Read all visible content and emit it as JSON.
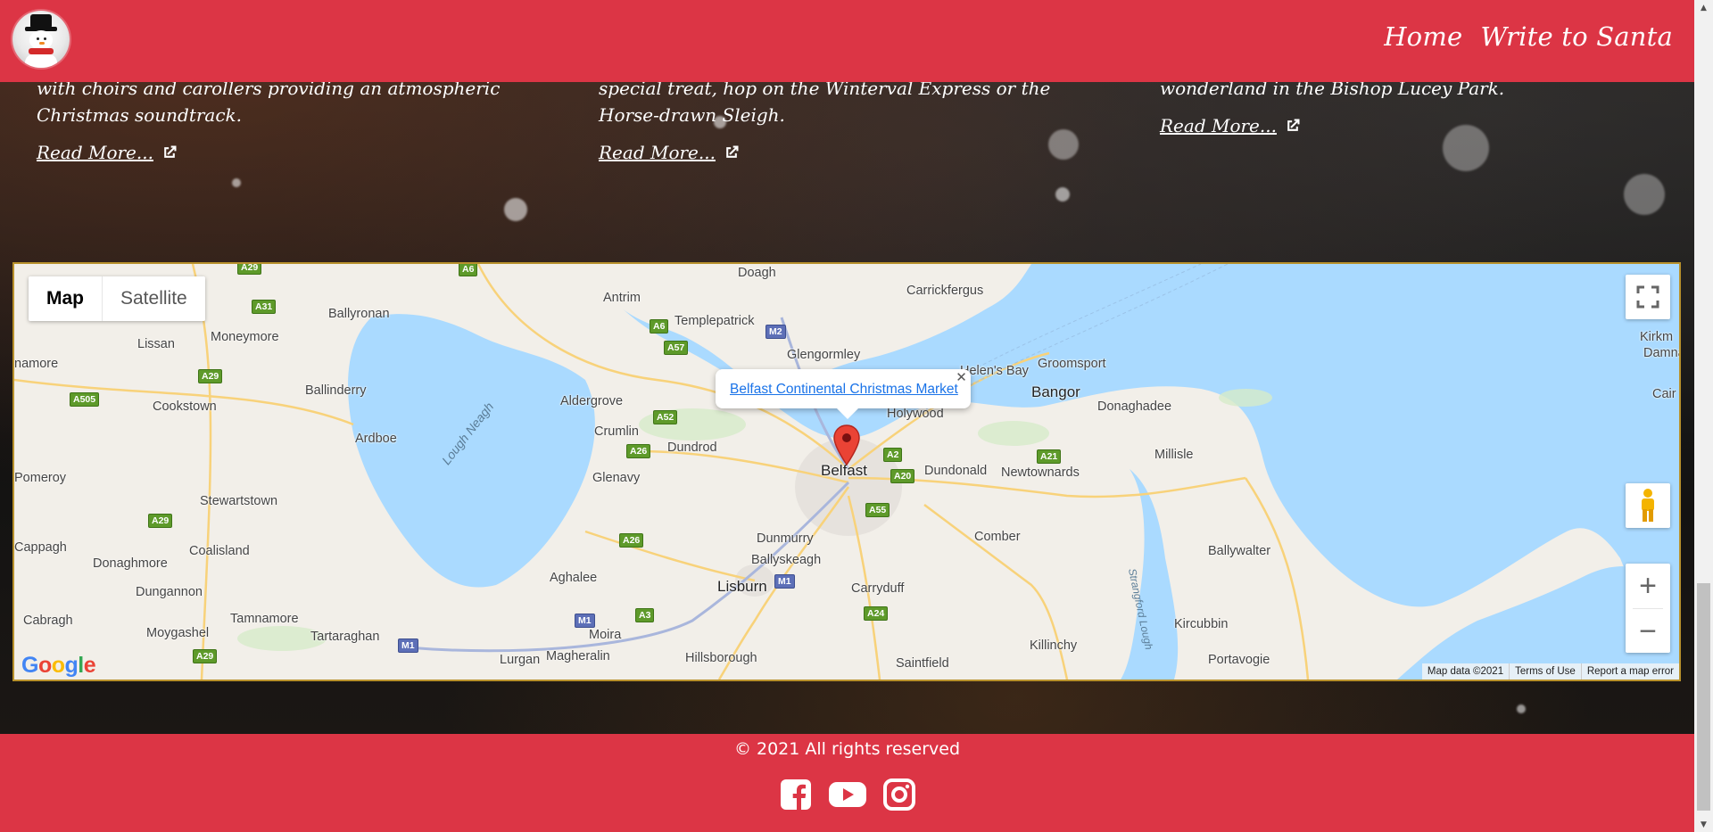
{
  "header": {
    "nav": [
      "Home",
      "Write to Santa"
    ]
  },
  "articles": [
    {
      "text": "with choirs and carollers providing an atmospheric Christmas soundtrack.",
      "read_more": "Read More..."
    },
    {
      "text": "special treat, hop on the Winterval Express or the Horse-drawn Sleigh.",
      "read_more": "Read More..."
    },
    {
      "text": "wonderland in the Bishop Lucey Park.",
      "read_more": "Read More..."
    }
  ],
  "map": {
    "type_buttons": [
      "Map",
      "Satellite"
    ],
    "active_type": "Map",
    "info_window_link": "Belfast Continental Christmas Market",
    "places": [
      "Doagh",
      "Carrickfergus",
      "Antrim",
      "Templepatrick",
      "Ballyronan",
      "Lissan",
      "Moneymore",
      "Glengormley",
      "Helen's Bay",
      "Groomsport",
      "Bangor",
      "Ballinderry",
      "Aldergrove",
      "Holywood",
      "Donaghadee",
      "Cookstown",
      "Ardboe",
      "Crumlin",
      "Dundrod",
      "Belfast",
      "Dundonald",
      "Newtownards",
      "Millisle",
      "Glenavy",
      "Stewartstown",
      "Pomeroy",
      "Dunmurry",
      "Comber",
      "Coalisland",
      "Ballyskeagh",
      "Ballywalter",
      "Cappagh",
      "Donaghmore",
      "Aghalee",
      "Dungannon",
      "Lisburn",
      "Carryduff",
      "Cabragh",
      "Tamnamore",
      "Moygashel",
      "Tartaraghan",
      "Moira",
      "Kircubbin",
      "Killinchy",
      "Lurgan",
      "Magheralin",
      "Hillsborough",
      "Saintfield",
      "Portavogie",
      "namore",
      "Po",
      "Kirkm",
      "Damna",
      "Cair"
    ],
    "water_labels": [
      "Lough Neagh",
      "Strangford Lough"
    ],
    "roads": [
      "A29",
      "A6",
      "A31",
      "M2",
      "A6",
      "A57",
      "A29",
      "A505",
      "A52",
      "A26",
      "A2",
      "A20",
      "A21",
      "A55",
      "A29",
      "A26",
      "M1",
      "A3",
      "M1",
      "A24",
      "A29",
      "M1"
    ],
    "logo": "Google",
    "attribution": [
      "Map data ©2021",
      "Terms of Use",
      "Report a map error"
    ],
    "zoom_in": "+",
    "zoom_out": "−"
  },
  "footer": {
    "copyright": "© 2021 All rights reserved",
    "social": [
      "facebook",
      "youtube",
      "instagram"
    ]
  },
  "colors": {
    "brand_red": "#dc3545",
    "map_border": "#b8912c",
    "link_blue": "#1a73e8"
  }
}
